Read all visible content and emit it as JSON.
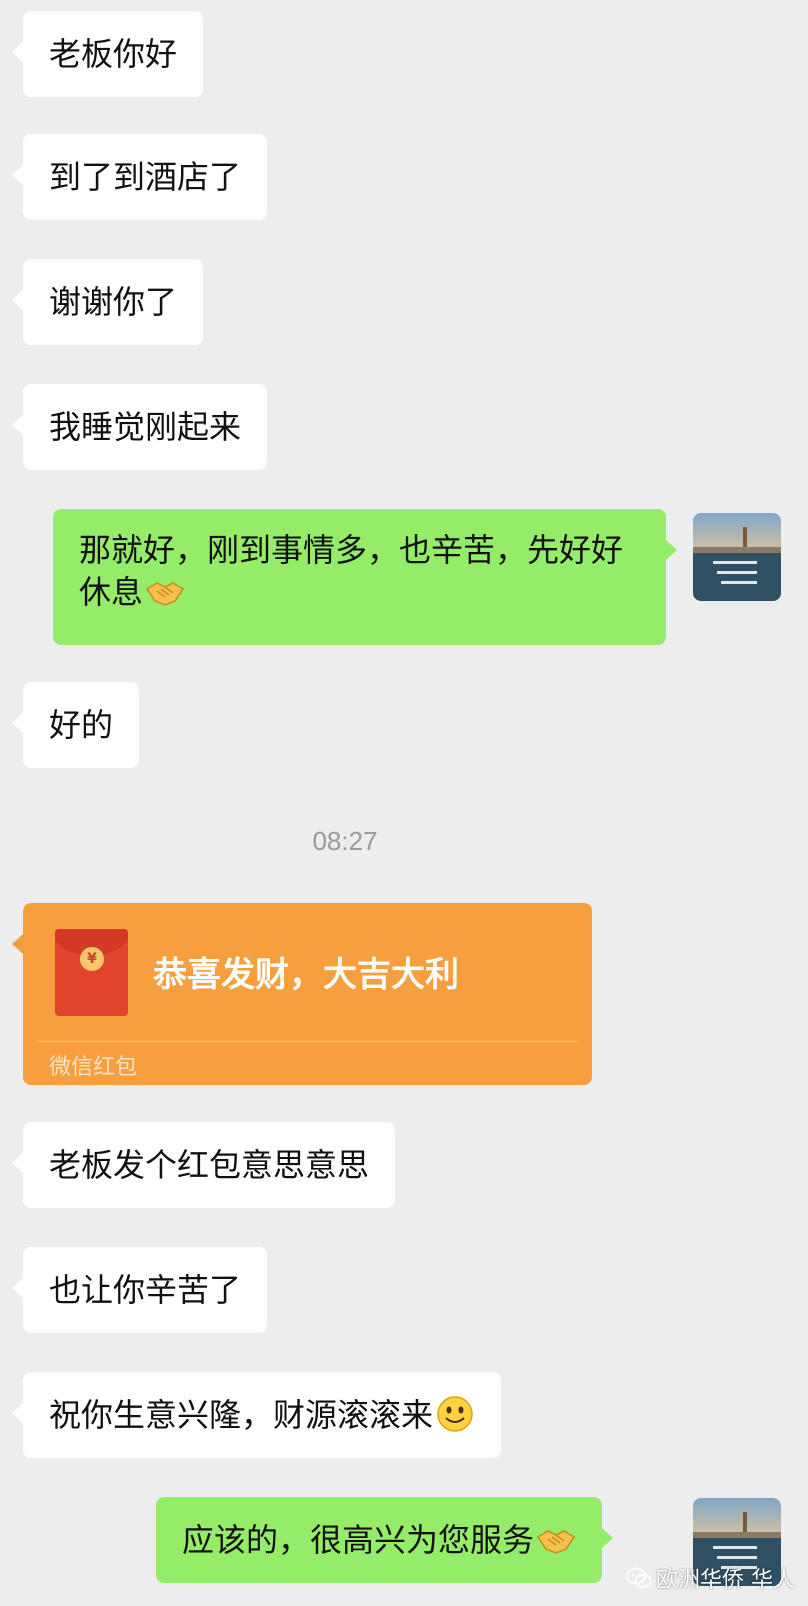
{
  "messages": [
    {
      "side": "in",
      "text": "老板你好"
    },
    {
      "side": "in",
      "text": "到了到酒店了"
    },
    {
      "side": "in",
      "text": "谢谢你了"
    },
    {
      "side": "in",
      "text": "我睡觉刚起来"
    },
    {
      "side": "out",
      "text": "那就好，刚到事情多，也辛苦，先好好休息",
      "emoji": "handshake-emoji"
    },
    {
      "side": "in",
      "text": "好的"
    },
    {
      "side": "in",
      "text": "老板发个红包意思意思"
    },
    {
      "side": "in",
      "text": "也让你辛苦了"
    },
    {
      "side": "in",
      "text": "祝你生意兴隆，财源滚滚来",
      "emoji": "smiling-face-emoji"
    },
    {
      "side": "out",
      "text": "应该的，很高兴为您服务",
      "emoji": "handshake-emoji"
    }
  ],
  "timestamp": "08:27",
  "red_packet": {
    "title": "恭喜发财，大吉大利",
    "footer": "微信红包",
    "icon": "red-envelope-icon",
    "coin_symbol": "¥",
    "color": "#f79f3f"
  },
  "watermark": {
    "text": "欧洲华侨 华人",
    "icon": "wechat-logo-icon"
  },
  "colors": {
    "background": "#ededed",
    "incoming_bubble": "#ffffff",
    "outgoing_bubble": "#95ec69"
  }
}
